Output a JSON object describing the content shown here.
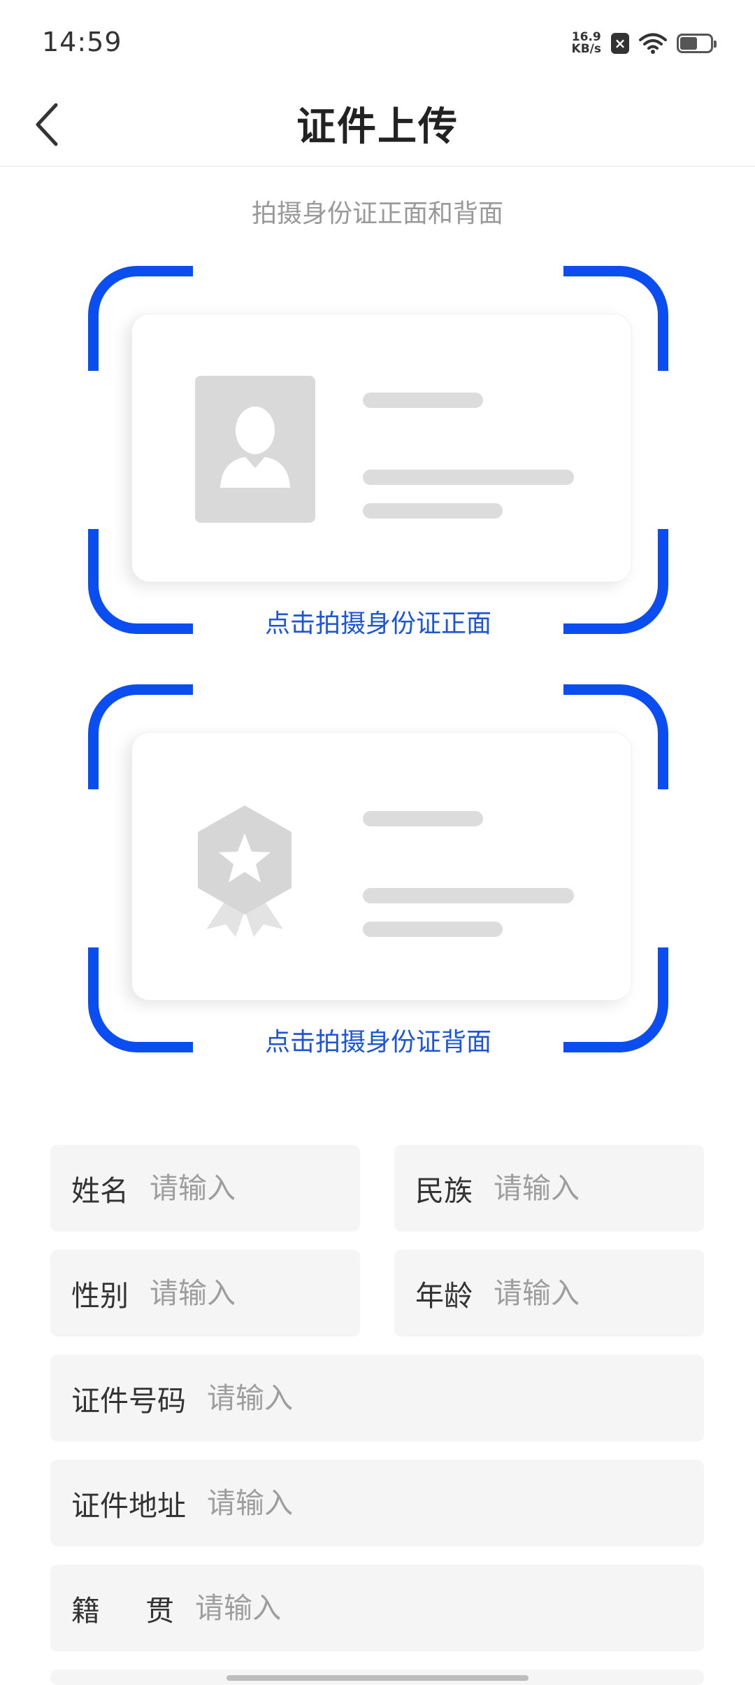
{
  "status_bar": {
    "time": "14:59",
    "net_speed_value": "16.9",
    "net_speed_unit": "KB/s",
    "icons": [
      "notification-icon",
      "wifi-icon",
      "battery-icon"
    ]
  },
  "nav": {
    "title": "证件上传",
    "back_icon": "chevron-left-icon"
  },
  "subtitle": "拍摄身份证正面和背面",
  "capture": {
    "front_label": "点击拍摄身份证正面",
    "back_label": "点击拍摄身份证背面",
    "accent_color": "#0a4df0",
    "label_color": "#1c55d6"
  },
  "form": {
    "name": {
      "label": "姓名",
      "placeholder": "请输入"
    },
    "ethnicity": {
      "label": "民族",
      "placeholder": "请输入"
    },
    "gender": {
      "label": "性别",
      "placeholder": "请输入"
    },
    "age": {
      "label": "年龄",
      "placeholder": "请输入"
    },
    "id_number": {
      "label": "证件号码",
      "placeholder": "请输入"
    },
    "id_address": {
      "label": "证件地址",
      "placeholder": "请输入"
    },
    "native_place": {
      "label": "籍     贯",
      "placeholder": "请输入"
    }
  }
}
